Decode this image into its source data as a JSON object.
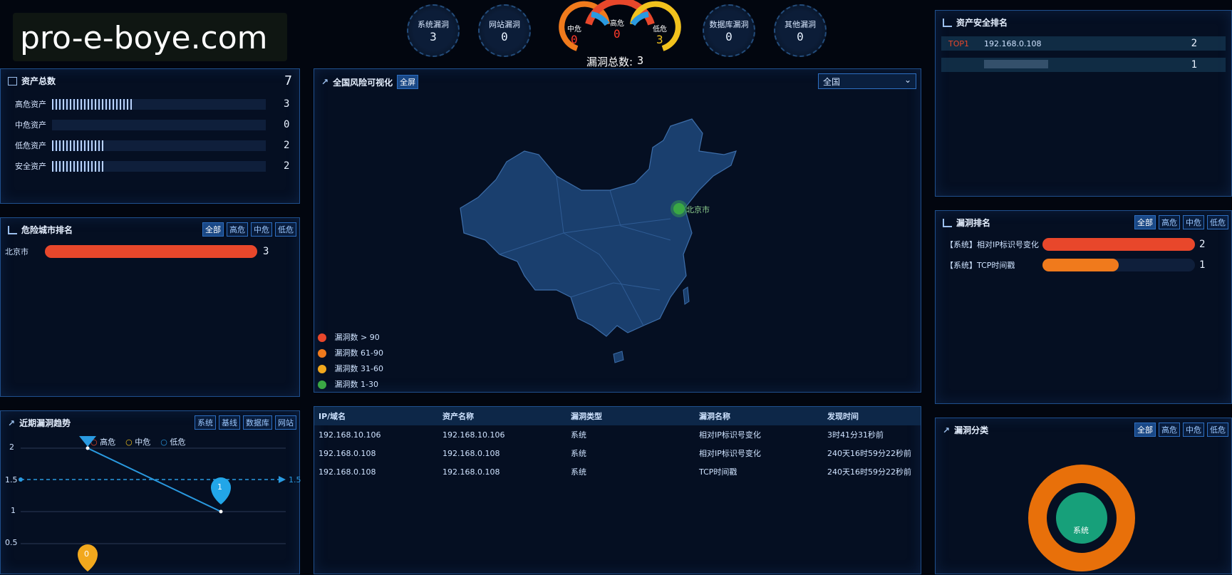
{
  "logo": {
    "watermark": "pro-e-boye.com"
  },
  "top_gauges": [
    {
      "label": "系统漏洞",
      "value": "3"
    },
    {
      "label": "网站漏洞",
      "value": "0"
    },
    {
      "label": "数据库漏洞",
      "value": "0"
    },
    {
      "label": "其他漏洞",
      "value": "0"
    }
  ],
  "risk_gauges": {
    "medium": {
      "label": "中危",
      "value": "0"
    },
    "high": {
      "label": "高危",
      "value": "0"
    },
    "low": {
      "label": "低危",
      "value": "3"
    },
    "total_label": "漏洞总数:",
    "total_value": "3"
  },
  "asset_total": {
    "title": "资产总数",
    "count": "7",
    "rows": [
      {
        "label": "高危资产",
        "value": "3",
        "fraction": 0.38
      },
      {
        "label": "中危资产",
        "value": "0",
        "fraction": 0.0
      },
      {
        "label": "低危资产",
        "value": "2",
        "fraction": 0.25
      },
      {
        "label": "安全资产",
        "value": "2",
        "fraction": 0.25
      }
    ]
  },
  "city_rank": {
    "title": "危险城市排名",
    "buttons": [
      "全部",
      "高危",
      "中危",
      "低危"
    ],
    "rows": [
      {
        "city": "北京市",
        "value": "3",
        "fraction": 1.0
      }
    ]
  },
  "trend": {
    "title": "近期漏洞趋势",
    "buttons": [
      "系统",
      "基线",
      "数据库",
      "网站"
    ],
    "legend": [
      "高危",
      "中危",
      "低危"
    ],
    "y_ticks": [
      "2",
      "1.5",
      "1",
      "0.5"
    ],
    "avg_label": "1.5",
    "pin_high": "1",
    "pin_mid": "0"
  },
  "map": {
    "title": "全国风险可视化",
    "fullscreen_label": "全屏",
    "region_select": "全国",
    "city_marker": "北京市",
    "legend": [
      {
        "label": "漏洞数 > 90",
        "color": "#e8472b"
      },
      {
        "label": "漏洞数 61-90",
        "color": "#f07a1c"
      },
      {
        "label": "漏洞数 31-60",
        "color": "#f2a81d"
      },
      {
        "label": "漏洞数 1-30",
        "color": "#3aa844"
      }
    ]
  },
  "vuln_table": {
    "headers": [
      "IP/域名",
      "资产名称",
      "漏洞类型",
      "漏洞名称",
      "发现时间"
    ],
    "rows": [
      [
        "192.168.10.106",
        "192.168.10.106",
        "系统",
        "相对IP标识号变化",
        "3时41分31秒前"
      ],
      [
        "192.168.0.108",
        "192.168.0.108",
        "系统",
        "相对IP标识号变化",
        "240天16时59分22秒前"
      ],
      [
        "192.168.0.108",
        "192.168.0.108",
        "系统",
        "TCP时间戳",
        "240天16时59分22秒前"
      ]
    ]
  },
  "asset_rank": {
    "title": "资产安全排名",
    "rows": [
      {
        "rank": "TOP1",
        "ip": "192.168.0.108",
        "value": "2"
      },
      {
        "rank": "",
        "ip": "",
        "value": "1"
      }
    ]
  },
  "vuln_rank": {
    "title": "漏洞排名",
    "buttons": [
      "全部",
      "高危",
      "中危",
      "低危"
    ],
    "rows": [
      {
        "name": "【系统】相对IP标识号变化",
        "value": "2",
        "fraction": 1.0,
        "color": "#e8472b"
      },
      {
        "name": "【系统】TCP时间戳",
        "value": "1",
        "fraction": 0.5,
        "color": "#f07a1c"
      }
    ]
  },
  "vuln_class": {
    "title": "漏洞分类",
    "buttons": [
      "全部",
      "高危",
      "中危",
      "低危"
    ],
    "center_label": "系统"
  }
}
